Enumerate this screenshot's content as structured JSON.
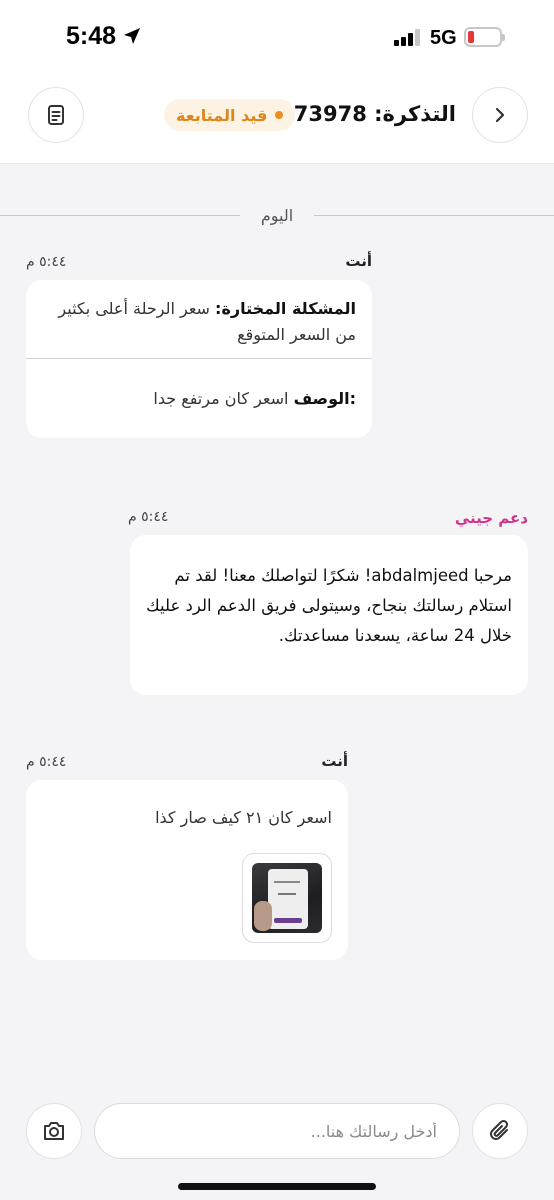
{
  "status_bar": {
    "time": "5:48",
    "network": "5G"
  },
  "header": {
    "ticket_title": "التذكرة: 54873978",
    "status_label": "قيد المتابعة",
    "status_color": "#ef8d1e",
    "back_icon": "chevron-right-icon",
    "details_icon": "document-icon"
  },
  "day_separator": "اليوم",
  "messages": [
    {
      "sender": "أنت",
      "time": "٥:٤٤ م",
      "issue_label": "المشكلة المختارة:",
      "issue_value": "سعر الرحلة أعلى بكثير من السعر المتوقع",
      "description_label": ":الوصف",
      "description_value": "اسعر كان مرتفع جدا"
    },
    {
      "sender": "دعم جيني",
      "sender_color": "#d0338a",
      "time": "٥:٤٤ م",
      "text": "مرحبا abdalmjeed! شكرًا لتواصلك معنا! لقد تم استلام رسالتك بنجاح، وسيتولى فريق الدعم الرد عليك خلال 24 ساعة، يسعدنا مساعدتك."
    },
    {
      "sender": "أنت",
      "time": "٥:٤٤ م",
      "text": "اسعر كان ٢١ كيف صار كذا",
      "attachment": "image-thumbnail"
    }
  ],
  "composer": {
    "placeholder": "أدخل رسالتك هنا...",
    "camera_icon": "camera-icon",
    "attach_icon": "paperclip-icon"
  }
}
